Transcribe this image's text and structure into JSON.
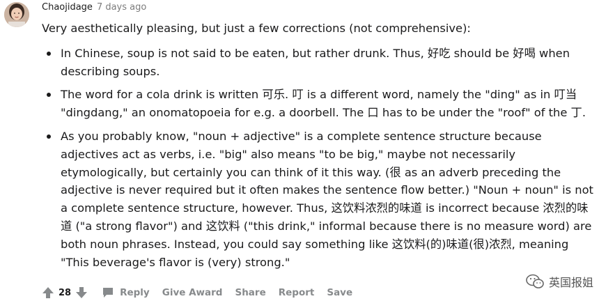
{
  "comment": {
    "author": "Chaojidage",
    "time_ago": "7 days ago",
    "intro": "Very aesthetically pleasing, but just a few corrections (not comprehensive):",
    "points": [
      "In Chinese, soup is not said to be eaten, but rather drunk. Thus, 好吃 should be 好喝 when describing soups.",
      "The word for a cola drink is written 可乐. 叮 is a different word, namely the \"ding\" as in 叮当 \"dingdang,\" an onomatopoeia for e.g. a doorbell. The 口 has to be under the \"roof\" of the 丁.",
      "As you probably know, \"noun + adjective\" is a complete sentence structure because adjectives act as verbs, i.e. \"big\" also means \"to be big,\" maybe not necessarily etymologically, but certainly you can think of it this way. (很 as an adverb preceding the adjective is never required but it often makes the sentence flow better.) \"Noun + noun\" is not a complete sentence structure, however. Thus, 这饮料浓烈的味道 is incorrect because 浓烈的味道 (\"a strong flavor\") and 这饮料 (\"this drink,\" informal because there is no measure word) are both noun phrases. Instead, you could say something like 这饮料(的)味道(很)浓烈, meaning \"This beverage's flavor is (very) strong.\""
    ]
  },
  "actions": {
    "vote_count": "28",
    "reply": "Reply",
    "give_award": "Give Award",
    "share": "Share",
    "report": "Report",
    "save": "Save"
  },
  "icons": {
    "upvote": "arrow-up-icon",
    "downvote": "arrow-down-icon",
    "reply": "speech-bubble-icon",
    "watermark": "wechat-icon"
  },
  "watermark": {
    "text": "英国报姐"
  },
  "colors": {
    "text": "#1a1a1b",
    "muted": "#878a8c",
    "timestamp": "#7c7c7c"
  }
}
